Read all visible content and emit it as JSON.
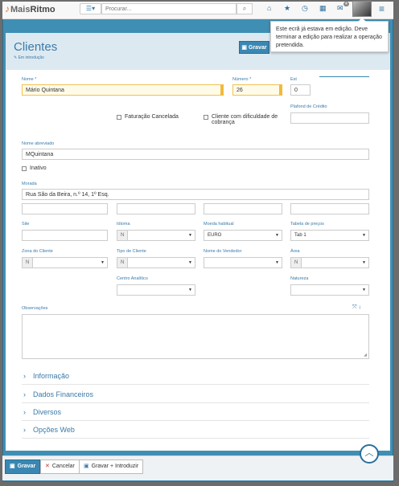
{
  "app": {
    "logo_prefix": "Mais",
    "logo_bold": "Ritmo"
  },
  "topbar": {
    "menu_icon": "list-icon",
    "search_placeholder": "Procurar...",
    "notification_count": "4"
  },
  "tooltip": {
    "text": "Este ecrã já estava em edição. Deve terminar a edição para realizar a operação pretendida."
  },
  "header": {
    "title": "Clientes",
    "subtitle": "Em introdução",
    "save_label": "Gravar"
  },
  "form": {
    "nome_label": "Nome *",
    "nome_value": "Mário Quintana",
    "numero_label": "Número *",
    "numero_value": "26",
    "est_label": "Est",
    "est_value": "0",
    "faturacao_label": "Faturação Cancelada",
    "dificuldade_label": "Cliente com dificuldade de cobrança",
    "plafond_label": "Plafond de Crédito",
    "plafond_value": "",
    "nome_abreviado_label": "Nome abreviado",
    "nome_abreviado_value": "MQuintana",
    "inativo_label": "Inativo",
    "morada_label": "Morada",
    "morada_value": "Rua São da Beira, n.º 14, 1º Esq.",
    "site_label": "Site",
    "site_value": "",
    "idioma_label": "Idioma",
    "idioma_value": "",
    "idioma_prefix": "N",
    "moeda_label": "Moeda habitual",
    "moeda_value": "EURO",
    "tabela_label": "Tabela de preços",
    "tabela_value": "Tab 1",
    "zona_label": "Zona do Cliente",
    "zona_prefix": "N",
    "tipo_label": "Tipo de Cliente",
    "tipo_prefix": "N",
    "vendedor_label": "Nome do Vendedor",
    "area_label": "Área",
    "area_prefix": "N",
    "centro_label": "Centro Analítico",
    "natureza_label": "Natureza",
    "observacoes_label": "Observações"
  },
  "sections": [
    {
      "label": "Informação"
    },
    {
      "label": "Dados Financeiros"
    },
    {
      "label": "Diversos"
    },
    {
      "label": "Opções Web"
    }
  ],
  "bottom": {
    "save_label": "Gravar",
    "cancel_label": "Cancelar",
    "save_new_label": "Gravar + Introduzir"
  },
  "colors": {
    "accent": "#3a87b3",
    "required": "#f2b93b",
    "frame": "#3f8fb4"
  }
}
